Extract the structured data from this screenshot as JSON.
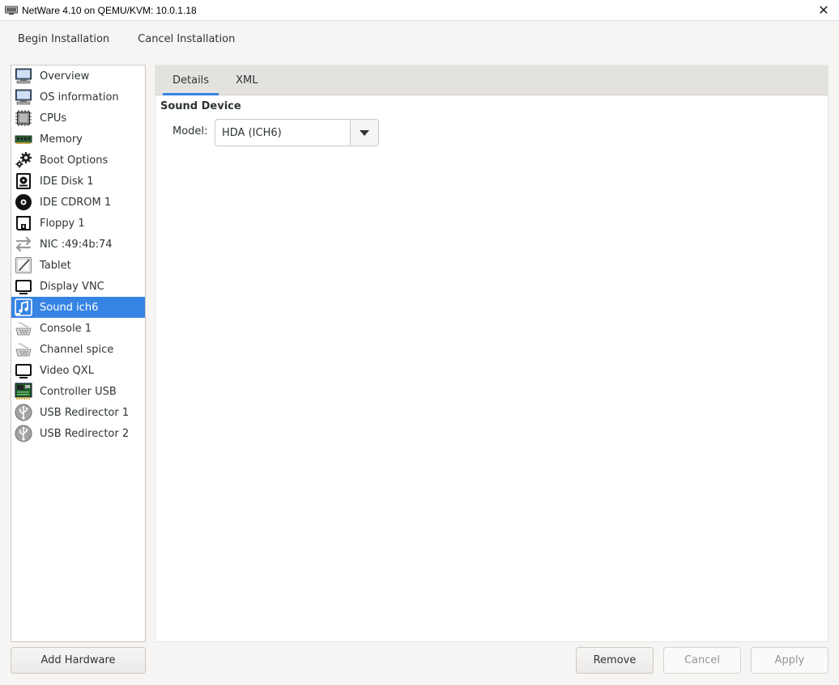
{
  "window": {
    "title": "NetWare 4.10 on QEMU/KVM: 10.0.1.18",
    "close_glyph": "✕"
  },
  "toolbar": {
    "begin_label": "Begin Installation",
    "cancel_label": "Cancel Installation"
  },
  "sidebar": {
    "items": [
      {
        "label": "Overview",
        "icon": "monitor-icon"
      },
      {
        "label": "OS information",
        "icon": "monitor-icon"
      },
      {
        "label": "CPUs",
        "icon": "cpu-chip-icon"
      },
      {
        "label": "Memory",
        "icon": "ram-module-icon"
      },
      {
        "label": "Boot Options",
        "icon": "gears-icon"
      },
      {
        "label": "IDE Disk 1",
        "icon": "hard-disk-icon"
      },
      {
        "label": "IDE CDROM 1",
        "icon": "cdrom-icon"
      },
      {
        "label": "Floppy 1",
        "icon": "floppy-icon"
      },
      {
        "label": "NIC :49:4b:74",
        "icon": "network-arrows-icon"
      },
      {
        "label": "Tablet",
        "icon": "tablet-pen-icon"
      },
      {
        "label": "Display VNC",
        "icon": "display-icon"
      },
      {
        "label": "Sound ich6",
        "icon": "sound-card-icon"
      },
      {
        "label": "Console 1",
        "icon": "serial-port-icon"
      },
      {
        "label": "Channel spice",
        "icon": "serial-port-icon"
      },
      {
        "label": "Video QXL",
        "icon": "display-icon"
      },
      {
        "label": "Controller USB",
        "icon": "controller-board-icon"
      },
      {
        "label": "USB Redirector 1",
        "icon": "usb-icon"
      },
      {
        "label": "USB Redirector 2",
        "icon": "usb-icon"
      }
    ],
    "selected_index": 11
  },
  "tabs": {
    "details": "Details",
    "xml": "XML"
  },
  "details": {
    "section_title": "Sound Device",
    "model_label": "Model:",
    "model_value": "HDA (ICH6)"
  },
  "buttons": {
    "add_hardware": "Add Hardware",
    "remove": "Remove",
    "cancel": "Cancel",
    "apply": "Apply"
  },
  "colors": {
    "accent": "#3584e4",
    "window_bg": "#f6f5f4"
  }
}
